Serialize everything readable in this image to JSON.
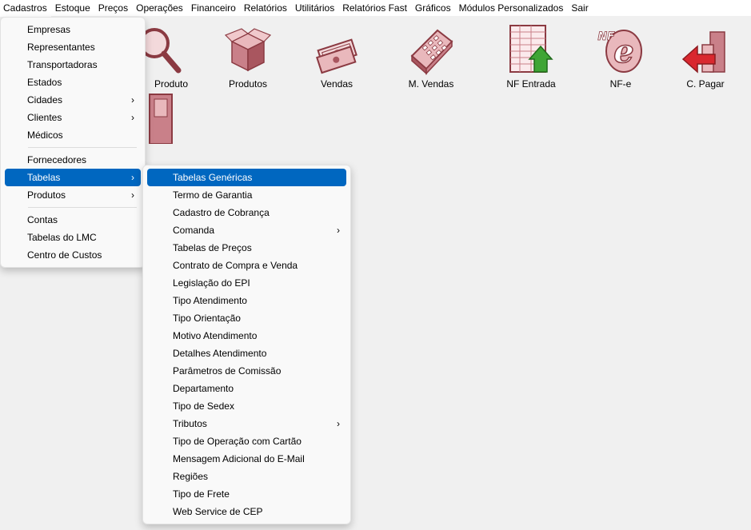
{
  "menubar": {
    "items": [
      {
        "label": "Cadastros"
      },
      {
        "label": "Estoque"
      },
      {
        "label": "Preços"
      },
      {
        "label": "Operações"
      },
      {
        "label": "Financeiro"
      },
      {
        "label": "Relatórios"
      },
      {
        "label": "Utilitários"
      },
      {
        "label": "Relatórios Fast"
      },
      {
        "label": "Gráficos"
      },
      {
        "label": "Módulos Personalizados"
      },
      {
        "label": "Sair"
      }
    ]
  },
  "toolbar": {
    "buttons": [
      {
        "label": "Produto",
        "icon": "magnifier-icon"
      },
      {
        "label": "Produtos",
        "icon": "box-icon"
      },
      {
        "label": "Vendas",
        "icon": "cash-icon"
      },
      {
        "label": "M. Vendas",
        "icon": "calculator-icon"
      },
      {
        "label": "NF Entrada",
        "icon": "spreadsheet-up-icon"
      },
      {
        "label": "NF-e",
        "icon": "nfe-icon"
      },
      {
        "label": "C. Pagar",
        "icon": "chart-arrow-icon"
      }
    ]
  },
  "cadastros_menu": {
    "items": [
      {
        "label": "Empresas"
      },
      {
        "label": "Representantes"
      },
      {
        "label": "Transportadoras"
      },
      {
        "label": "Estados"
      },
      {
        "label": "Cidades",
        "arrow": "›"
      },
      {
        "label": "Clientes",
        "arrow": "›"
      },
      {
        "label": "Médicos"
      },
      {
        "label": "Fornecedores"
      },
      {
        "label": "Tabelas",
        "arrow": "›"
      },
      {
        "label": "Produtos",
        "arrow": "›"
      },
      {
        "label": "Contas"
      },
      {
        "label": "Tabelas do LMC"
      },
      {
        "label": "Centro de Custos"
      }
    ]
  },
  "tabelas_menu": {
    "items": [
      {
        "label": "Tabelas Genéricas"
      },
      {
        "label": "Termo de Garantia"
      },
      {
        "label": "Cadastro de Cobrança"
      },
      {
        "label": "Comanda",
        "arrow": "›"
      },
      {
        "label": "Tabelas de Preços"
      },
      {
        "label": "Contrato de Compra e Venda"
      },
      {
        "label": "Legislação do EPI"
      },
      {
        "label": "Tipo Atendimento"
      },
      {
        "label": "Tipo Orientação"
      },
      {
        "label": "Motivo Atendimento"
      },
      {
        "label": "Detalhes Atendimento"
      },
      {
        "label": "Parâmetros de Comissão"
      },
      {
        "label": "Departamento"
      },
      {
        "label": "Tipo de Sedex"
      },
      {
        "label": "Tributos",
        "arrow": "›"
      },
      {
        "label": "Tipo de Operação com Cartão"
      },
      {
        "label": "Mensagem Adicional do E-Mail"
      },
      {
        "label": "Regiões"
      },
      {
        "label": "Tipo de Frete"
      },
      {
        "label": "Web Service de CEP"
      }
    ]
  },
  "colors": {
    "highlight": "#0067c0",
    "icon_pink": "#d9a0a4",
    "icon_dark": "#8b3a42"
  }
}
